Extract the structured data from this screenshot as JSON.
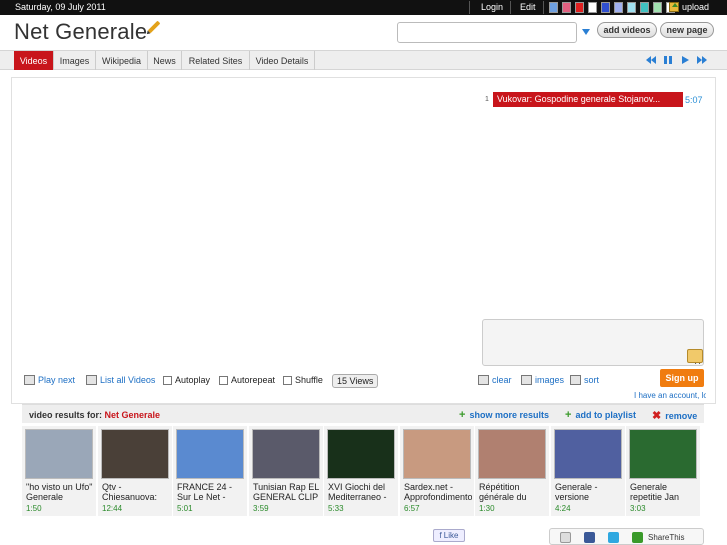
{
  "topbar": {
    "date": "Saturday, 09 July 2011",
    "login": "Login",
    "edit": "Edit",
    "upload": "upload",
    "swatches": [
      "#6fa0e0",
      "#e06080",
      "#e02020",
      "#ffffff",
      "#3050d0",
      "#a0b0f0",
      "#a0e0f0",
      "#40c0c0",
      "#a0e0b0",
      "#ffffff"
    ]
  },
  "header": {
    "title": "Net Generale",
    "search_placeholder": "",
    "add_videos": "add videos",
    "new_page": "new page"
  },
  "tabs": [
    {
      "label": "Videos",
      "active": true
    },
    {
      "label": "Images",
      "active": false
    },
    {
      "label": "Wikipedia",
      "active": false
    },
    {
      "label": "News",
      "active": false
    },
    {
      "label": "Related Sites",
      "active": false
    },
    {
      "label": "Video Details",
      "active": false
    }
  ],
  "playlist": {
    "number": "1",
    "title": "Vukovar: Gospodine generale Stojanov...",
    "duration": "5:07"
  },
  "controls": {
    "play_next": "Play next",
    "list_all": "List all Videos",
    "autoplay": "Autoplay",
    "autorepeat": "Autorepeat",
    "shuffle": "Shuffle",
    "views": "15 Views",
    "clear": "clear",
    "images": "images",
    "sort": "sort",
    "sign_up": "Sign up",
    "have_account": "I have an account, lo"
  },
  "results": {
    "label": "video results for:",
    "query": "Net Generale",
    "show_more": "show more results",
    "add_playlist": "add to playlist",
    "remove": "remove"
  },
  "videos": [
    {
      "title": "\"ho visto un Ufo\" Generale",
      "duration": "1:50",
      "thumb": "#9aa7b8"
    },
    {
      "title": "Qtv - Chiesanuova:",
      "duration": "12:44",
      "thumb": "#4a4038"
    },
    {
      "title": "FRANCE 24 - Sur Le Net -",
      "duration": "5:01",
      "thumb": "#5a8ad0"
    },
    {
      "title": "Tunisian Rap EL GENERAL CLIP",
      "duration": "3:59",
      "thumb": "#5a5a6a"
    },
    {
      "title": "XVI Giochi del Mediterraneo -",
      "duration": "5:33",
      "thumb": "#18301a"
    },
    {
      "title": "Sardex.net - Approfondimento",
      "duration": "6:57",
      "thumb": "#c89a80"
    },
    {
      "title": "Répétition générale du",
      "duration": "1:30",
      "thumb": "#b08070"
    },
    {
      "title": "Generale - versione",
      "duration": "4:24",
      "thumb": "#5060a0"
    },
    {
      "title": "Generale repetitie Jan",
      "duration": "3:03",
      "thumb": "#2a6a30"
    }
  ],
  "footer": {
    "like": "Like",
    "share_this": "ShareThis"
  }
}
